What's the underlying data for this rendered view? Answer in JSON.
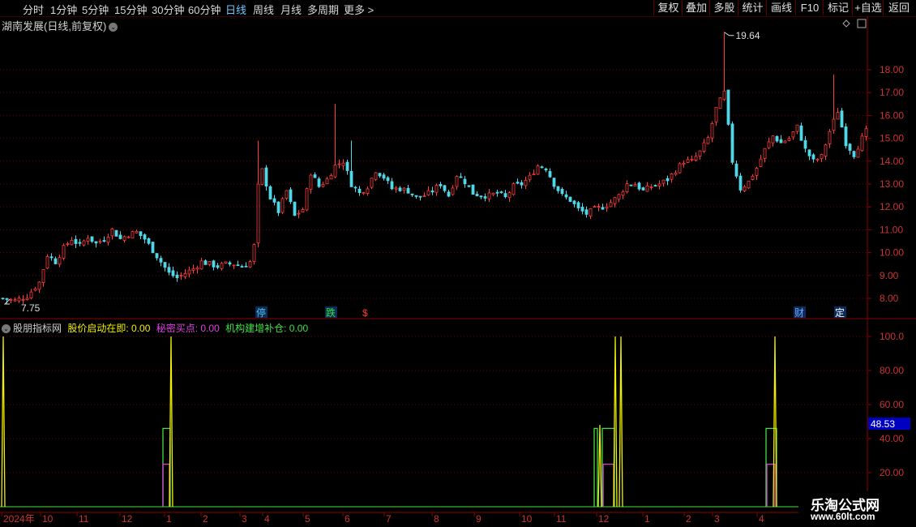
{
  "toolbar": {
    "periods": [
      "分时",
      "1分钟",
      "5分钟",
      "15分钟",
      "30分钟",
      "60分钟",
      "日线",
      "周线",
      "月线",
      "多周期",
      "更多 >"
    ],
    "active_period": "日线",
    "buttons": [
      "复权",
      "叠加",
      "多股",
      "统计",
      "画线",
      "F10",
      "标记",
      "+自选",
      "返回"
    ]
  },
  "chart": {
    "title": "湖南发展(日线,前复权)",
    "high_label": "19.64",
    "low_label": "7.75",
    "price_ticks": [
      "18.00",
      "17.00",
      "16.00",
      "15.00",
      "14.00",
      "13.00",
      "12.00",
      "11.00",
      "10.00",
      "9.00",
      "8.00"
    ],
    "markers": [
      {
        "text": "停",
        "color": "#4ec3e0"
      },
      {
        "text": "跌",
        "color": "#2ee82e"
      },
      {
        "text": "$",
        "color": "#ff3030"
      },
      {
        "text": "财",
        "color": "#6ea8ff"
      },
      {
        "text": "定",
        "color": "#ffffff"
      }
    ]
  },
  "indicator": {
    "name": "股朋指标网",
    "series": [
      {
        "label": "股价启动在即: 0.00",
        "color": "#f0f000"
      },
      {
        "label": "秘密买点: 0.00",
        "color": "#e040e0"
      },
      {
        "label": "机构建增补仓: 0.00",
        "color": "#40e040"
      }
    ],
    "ticks": [
      "100.0",
      "80.00",
      "60.00",
      "40.00",
      "20.00"
    ],
    "current_value": "48.53"
  },
  "xaxis": {
    "labels": [
      "2024年",
      "10",
      "11",
      "12",
      "1",
      "2",
      "3",
      "4",
      "5",
      "6",
      "7",
      "8",
      "9",
      "10",
      "11",
      "12",
      "1",
      "2",
      "3",
      "4"
    ]
  },
  "watermark": {
    "line1": "乐淘公式网",
    "line2": "www.60lt.com"
  },
  "colors": {
    "up": "#ff3b3b",
    "down": "#4fd8e8",
    "grid": "#6a0000",
    "axis": "#8a0000"
  },
  "chart_data": {
    "type": "candlestick",
    "title": "湖南发展(日线,前复权)",
    "y_range": [
      7.4,
      20.0
    ],
    "close_trend": [
      [
        0,
        8.0
      ],
      [
        3,
        7.9
      ],
      [
        6,
        8.1
      ],
      [
        9,
        8.7
      ],
      [
        11,
        9.9
      ],
      [
        13,
        9.6
      ],
      [
        15,
        10.2
      ],
      [
        17,
        10.6
      ],
      [
        19,
        10.3
      ],
      [
        21,
        10.7
      ],
      [
        23,
        10.4
      ],
      [
        25,
        10.6
      ],
      [
        27,
        11.0
      ],
      [
        29,
        10.6
      ],
      [
        31,
        10.8
      ],
      [
        33,
        10.9
      ],
      [
        35,
        10.6
      ],
      [
        37,
        10.1
      ],
      [
        39,
        9.6
      ],
      [
        41,
        9.1
      ],
      [
        43,
        8.9
      ],
      [
        45,
        9.1
      ],
      [
        47,
        9.3
      ],
      [
        49,
        9.6
      ],
      [
        51,
        9.5
      ],
      [
        53,
        9.4
      ],
      [
        55,
        9.5
      ],
      [
        57,
        9.5
      ],
      [
        59,
        9.4
      ],
      [
        61,
        9.6
      ],
      [
        62,
        10.3
      ],
      [
        63,
        12.9
      ],
      [
        64,
        13.6
      ],
      [
        66,
        12.4
      ],
      [
        68,
        11.8
      ],
      [
        70,
        12.7
      ],
      [
        72,
        11.6
      ],
      [
        74,
        11.9
      ],
      [
        76,
        13.5
      ],
      [
        78,
        12.9
      ],
      [
        80,
        13.2
      ],
      [
        82,
        13.8
      ],
      [
        84,
        14.0
      ],
      [
        86,
        13.0
      ],
      [
        88,
        12.6
      ],
      [
        90,
        12.9
      ],
      [
        92,
        13.6
      ],
      [
        94,
        13.3
      ],
      [
        96,
        12.8
      ],
      [
        98,
        12.8
      ],
      [
        100,
        12.7
      ],
      [
        102,
        12.4
      ],
      [
        104,
        12.5
      ],
      [
        106,
        12.7
      ],
      [
        108,
        13.0
      ],
      [
        110,
        12.5
      ],
      [
        112,
        13.4
      ],
      [
        114,
        13.1
      ],
      [
        116,
        12.6
      ],
      [
        118,
        12.5
      ],
      [
        120,
        12.5
      ],
      [
        122,
        12.6
      ],
      [
        124,
        12.4
      ],
      [
        126,
        12.9
      ],
      [
        128,
        13.0
      ],
      [
        130,
        13.3
      ],
      [
        132,
        13.8
      ],
      [
        134,
        13.7
      ],
      [
        136,
        13.0
      ],
      [
        138,
        12.5
      ],
      [
        140,
        12.3
      ],
      [
        142,
        11.9
      ],
      [
        144,
        11.7
      ],
      [
        146,
        11.9
      ],
      [
        148,
        12.0
      ],
      [
        150,
        12.2
      ],
      [
        152,
        12.5
      ],
      [
        154,
        13.0
      ],
      [
        156,
        13.0
      ],
      [
        158,
        12.7
      ],
      [
        160,
        12.9
      ],
      [
        162,
        13.0
      ],
      [
        164,
        13.2
      ],
      [
        166,
        13.6
      ],
      [
        168,
        14.0
      ],
      [
        170,
        14.0
      ],
      [
        172,
        14.4
      ],
      [
        174,
        15.0
      ],
      [
        176,
        16.3
      ],
      [
        178,
        17.0
      ],
      [
        180,
        14.0
      ],
      [
        182,
        12.8
      ],
      [
        184,
        13.1
      ],
      [
        186,
        13.7
      ],
      [
        188,
        14.5
      ],
      [
        190,
        15.1
      ],
      [
        192,
        14.8
      ],
      [
        194,
        15.0
      ],
      [
        196,
        15.5
      ],
      [
        198,
        14.5
      ],
      [
        200,
        14.0
      ],
      [
        202,
        14.2
      ],
      [
        204,
        15.3
      ],
      [
        206,
        16.2
      ],
      [
        208,
        14.8
      ],
      [
        210,
        14.3
      ],
      [
        212,
        15.0
      ],
      [
        213,
        15.3
      ]
    ],
    "highest": 19.64,
    "lowest": 7.75
  }
}
